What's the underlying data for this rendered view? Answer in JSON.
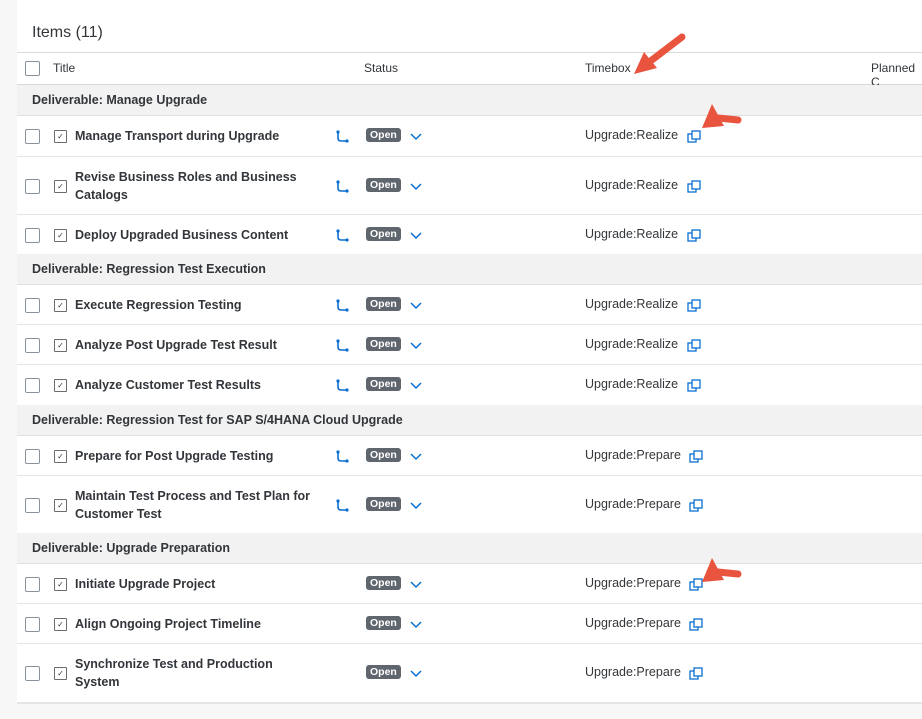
{
  "table": {
    "title": "Items (11)",
    "columns": [
      "Title",
      "Status",
      "Timebox",
      "Planned C"
    ]
  },
  "groups": [
    {
      "label": "Deliverable: Manage Upgrade",
      "items": [
        {
          "title": "Manage Transport during Upgrade",
          "status": "Open",
          "timebox": "Upgrade:Realize",
          "hierarchy_icon": true
        },
        {
          "title": "Revise Business Roles and Business Catalogs",
          "status": "Open",
          "timebox": "Upgrade:Realize",
          "hierarchy_icon": true
        },
        {
          "title": "Deploy Upgraded Business Content",
          "status": "Open",
          "timebox": "Upgrade:Realize",
          "hierarchy_icon": true
        }
      ]
    },
    {
      "label": "Deliverable: Regression Test Execution",
      "items": [
        {
          "title": "Execute Regression Testing",
          "status": "Open",
          "timebox": "Upgrade:Realize",
          "hierarchy_icon": true
        },
        {
          "title": "Analyze Post Upgrade Test Result",
          "status": "Open",
          "timebox": "Upgrade:Realize",
          "hierarchy_icon": true
        },
        {
          "title": "Analyze Customer Test Results",
          "status": "Open",
          "timebox": "Upgrade:Realize",
          "hierarchy_icon": true
        }
      ]
    },
    {
      "label": "Deliverable: Regression Test for SAP S/4HANA Cloud Upgrade",
      "items": [
        {
          "title": "Prepare for Post Upgrade Testing",
          "status": "Open",
          "timebox": "Upgrade:Prepare",
          "hierarchy_icon": true
        },
        {
          "title": "Maintain Test Process and Test Plan for Customer Test",
          "status": "Open",
          "timebox": "Upgrade:Prepare",
          "hierarchy_icon": true
        }
      ]
    },
    {
      "label": "Deliverable: Upgrade Preparation",
      "items": [
        {
          "title": "Initiate Upgrade Project",
          "status": "Open",
          "timebox": "Upgrade:Prepare",
          "hierarchy_icon": false
        },
        {
          "title": "Align Ongoing Project Timeline",
          "status": "Open",
          "timebox": "Upgrade:Prepare",
          "hierarchy_icon": false
        },
        {
          "title": "Synchronize Test and Production System",
          "status": "Open",
          "timebox": "Upgrade:Prepare",
          "hierarchy_icon": false
        }
      ]
    }
  ],
  "icons": {
    "task": "task-checkbox-icon",
    "hierarchy": "hierarchy-link-icon",
    "dropdown": "chevron-down-icon",
    "open_link": "external-link-icon",
    "annotation": "red-arrow-icon"
  },
  "colors": {
    "accent": "#0a6ed1",
    "badge": "#5f666d",
    "group_bg": "#f2f2f2",
    "annotation": "#e9543f"
  }
}
